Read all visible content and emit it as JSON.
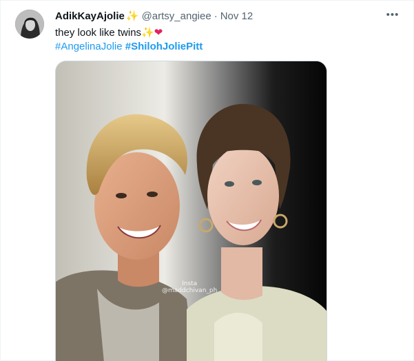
{
  "tweet": {
    "display_name": "AdikKayAjolie",
    "name_emoji": "✨",
    "handle": "@artsy_angiee",
    "separator": "·",
    "date": "Nov 12",
    "more_label": "•••",
    "text": "they look like twins",
    "text_emoji_1": "✨",
    "text_emoji_2": "❤",
    "hashtags": [
      "#AngelinaJolie",
      "#ShilohJoliePitt"
    ],
    "media": {
      "watermark_line1": "Insta",
      "watermark_line2": "@maddchivan_ph"
    }
  },
  "colors": {
    "link": "#1d9bf0",
    "secondary_text": "#536471",
    "primary_text": "#0f1419"
  }
}
